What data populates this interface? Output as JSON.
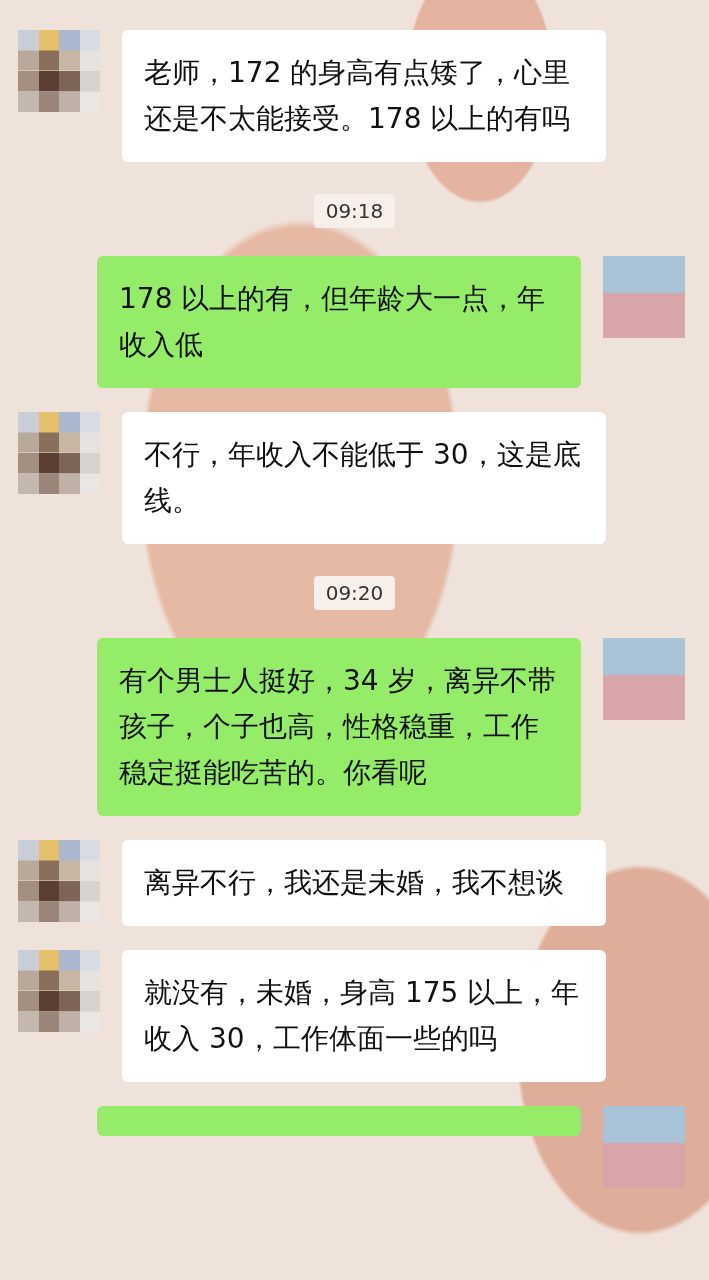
{
  "messages": [
    {
      "kind": "message",
      "outgoing": false,
      "text": "老师，172 的身高有点矮了，心里还是不太能接受。178 以上的有吗"
    },
    {
      "kind": "time",
      "text": "09:18"
    },
    {
      "kind": "message",
      "outgoing": true,
      "text": "178 以上的有，但年龄大一点，年收入低"
    },
    {
      "kind": "message",
      "outgoing": false,
      "text": "不行，年收入不能低于 30，这是底线。"
    },
    {
      "kind": "time",
      "text": "09:20"
    },
    {
      "kind": "message",
      "outgoing": true,
      "text": "有个男士人挺好，34 岁，离异不带孩子，个子也高，性格稳重，工作稳定挺能吃苦的。你看呢"
    },
    {
      "kind": "message",
      "outgoing": false,
      "text": "离异不行，我还是未婚，我不想谈"
    },
    {
      "kind": "message",
      "outgoing": false,
      "text": "就没有，未婚，身高 175 以上，年收入 30，工作体面一些的吗"
    },
    {
      "kind": "partial",
      "outgoing": true
    }
  ]
}
